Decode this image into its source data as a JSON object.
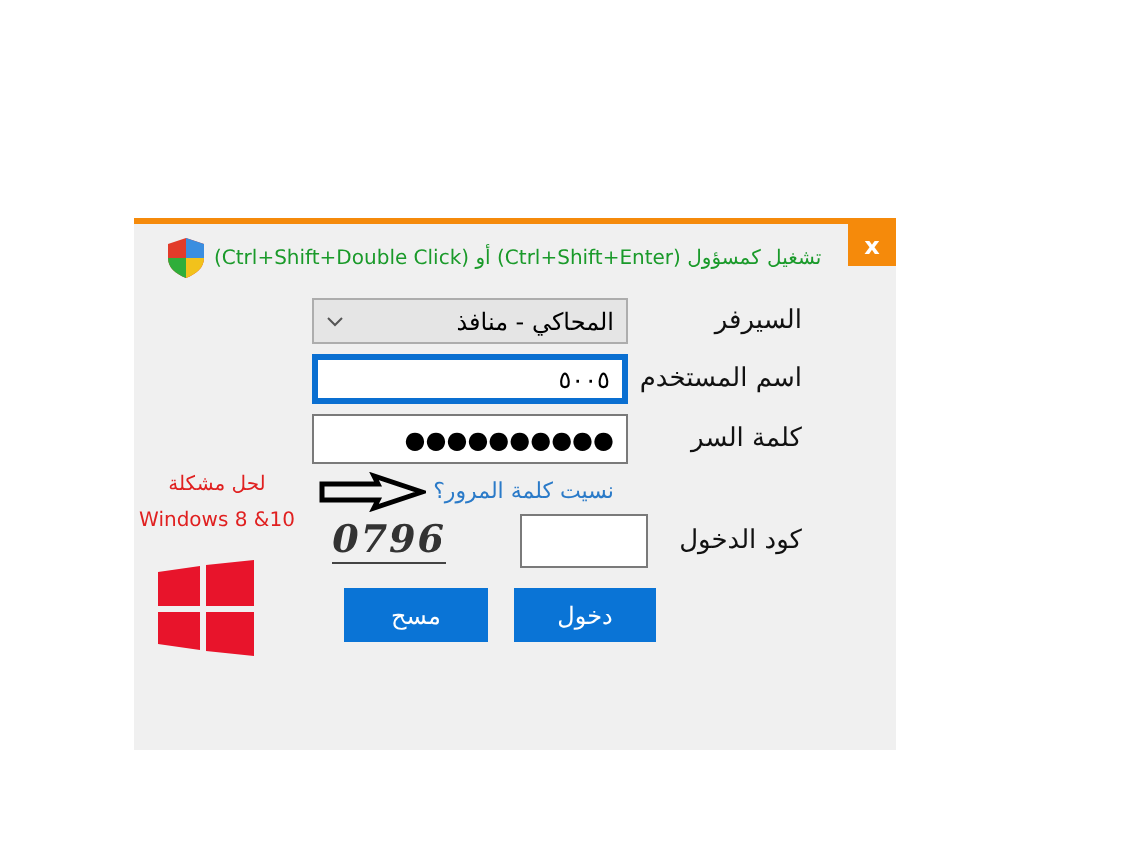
{
  "dialog": {
    "close": "x",
    "hint": "تشغيل كمسؤول (Ctrl+Shift+Enter) أو (Ctrl+Shift+Double Click)"
  },
  "fields": [
    {
      "kind": "select",
      "label": "السيرفر",
      "value": "المحاكي - منافذ",
      "focused": false
    },
    {
      "kind": "text",
      "label": "اسم المستخدم",
      "value": "٥٠٠٥",
      "focused": true
    },
    {
      "kind": "text",
      "label": "كلمة السر",
      "value": "●●●●●●●●●●",
      "focused": false
    }
  ],
  "forgot_link": "نسيت كلمة المرور؟",
  "help": {
    "lines": [
      "لحل مشكلة",
      "Windows 8 &10"
    ]
  },
  "captcha": {
    "label": "كود الدخول",
    "code": "0796"
  },
  "buttons": [
    {
      "label": "دخول"
    },
    {
      "label": "مسح"
    }
  ]
}
